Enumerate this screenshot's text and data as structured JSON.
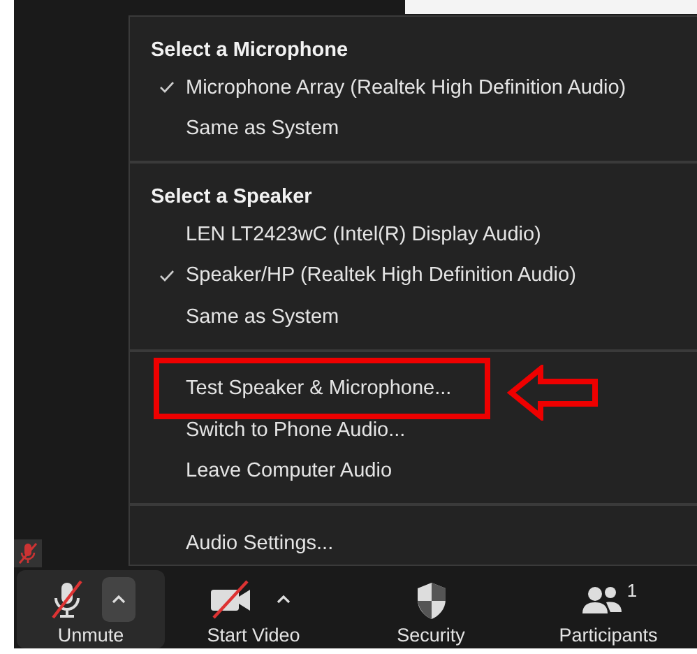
{
  "menu": {
    "sections": [
      {
        "header": "Select a Microphone",
        "items": [
          {
            "label": "Microphone Array (Realtek High Definition Audio)",
            "checked": true,
            "highlighted": false
          },
          {
            "label": "Same as System",
            "checked": false,
            "highlighted": false
          }
        ]
      },
      {
        "header": "Select a Speaker",
        "items": [
          {
            "label": "LEN LT2423wC (Intel(R) Display Audio)",
            "checked": false,
            "highlighted": false
          },
          {
            "label": "Speaker/HP (Realtek High Definition Audio)",
            "checked": true,
            "highlighted": false
          },
          {
            "label": "Same as System",
            "checked": false,
            "highlighted": false
          }
        ]
      },
      {
        "items": [
          {
            "label": "Test Speaker & Microphone...",
            "checked": false,
            "highlighted": true
          },
          {
            "label": "Switch to Phone Audio...",
            "checked": false,
            "highlighted": false
          },
          {
            "label": "Leave Computer Audio",
            "checked": false,
            "highlighted": false
          }
        ]
      },
      {
        "items": [
          {
            "label": "Audio Settings...",
            "checked": false,
            "highlighted": false
          }
        ]
      }
    ]
  },
  "toolbar": [
    {
      "kind": "mic",
      "label": "Unmute",
      "off": true,
      "caret": true,
      "selected": true
    },
    {
      "kind": "video",
      "label": "Start Video",
      "off": true,
      "caret": true,
      "selected": false
    },
    {
      "kind": "security",
      "label": "Security",
      "selected": false
    },
    {
      "kind": "participants",
      "label": "Participants",
      "selected": false,
      "count": "1"
    }
  ]
}
